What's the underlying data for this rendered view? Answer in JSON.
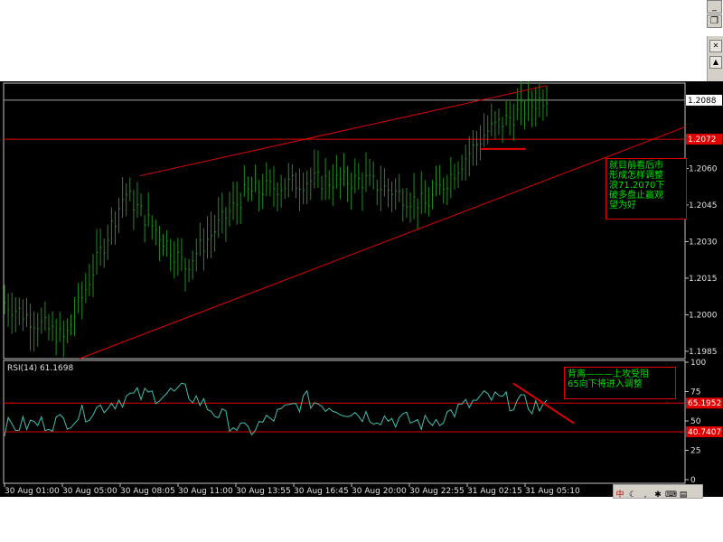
{
  "window_controls": {
    "minimize": "_",
    "restore": "❐",
    "close": "✕"
  },
  "price_axis": {
    "ticks": [
      "1.2060",
      "1.2045",
      "1.2030",
      "1.2015",
      "1.2000",
      "1.1985"
    ],
    "current_label": "1.2088",
    "line_label": "1.2072"
  },
  "rsi_axis": {
    "ticks": [
      "100",
      "75",
      "50",
      "25",
      "0"
    ],
    "upper_label": "65.1952",
    "lower_label": "40.7407"
  },
  "rsi_title": "RSI(14)  61.1698",
  "time_axis": [
    "30 Aug 01:00",
    "30 Aug 05:00",
    "30 Aug 08:05",
    "30 Aug 11:00",
    "30 Aug 13:55",
    "30 Aug 16:45",
    "30 Aug 20:00",
    "30 Aug 22:55",
    "31 Aug 02:15",
    "31 Aug 05:10"
  ],
  "annotations": {
    "main_note": "就目前看后市\n形成怎样调整\n浪71.2070下\n破多盘止赢观\n望为好",
    "rsi_note": "背离———上攻受阻\n65向下将进入调整"
  },
  "colors": {
    "bars": "#228b22",
    "rsi_line": "#40c0b0",
    "trend": "#e00000",
    "background": "#000000"
  },
  "chart_data": [
    {
      "type": "bar",
      "title": "",
      "x": [
        "30 Aug 01:00",
        "30 Aug 05:00",
        "30 Aug 08:05",
        "30 Aug 11:00",
        "30 Aug 13:55",
        "30 Aug 16:45",
        "30 Aug 20:00",
        "30 Aug 22:55",
        "31 Aug 02:15",
        "31 Aug 05:10"
      ],
      "series": [
        {
          "values": [
            1.2005,
            1.199,
            1.205,
            1.202,
            1.205,
            1.2055,
            1.2055,
            1.2045,
            1.2075,
            1.209
          ]
        }
      ],
      "ylim": [
        1.1982,
        1.2095
      ],
      "hlines": [
        1.2088,
        1.2072
      ],
      "grid": false,
      "xlabel": "",
      "ylabel": ""
    },
    {
      "type": "line",
      "title": "RSI(14)  61.1698",
      "x": [
        "30 Aug 01:00",
        "30 Aug 05:00",
        "30 Aug 08:05",
        "30 Aug 11:00",
        "30 Aug 13:55",
        "30 Aug 16:45",
        "30 Aug 20:00",
        "30 Aug 22:55",
        "31 Aug 02:15",
        "31 Aug 05:10"
      ],
      "series": [
        {
          "values": [
            45,
            50,
            70,
            75,
            40,
            68,
            55,
            48,
            70,
            61
          ]
        }
      ],
      "ylim": [
        0,
        100
      ],
      "hlines": [
        65.1952,
        40.7407
      ],
      "grid": false,
      "xlabel": "",
      "ylabel": ""
    }
  ]
}
